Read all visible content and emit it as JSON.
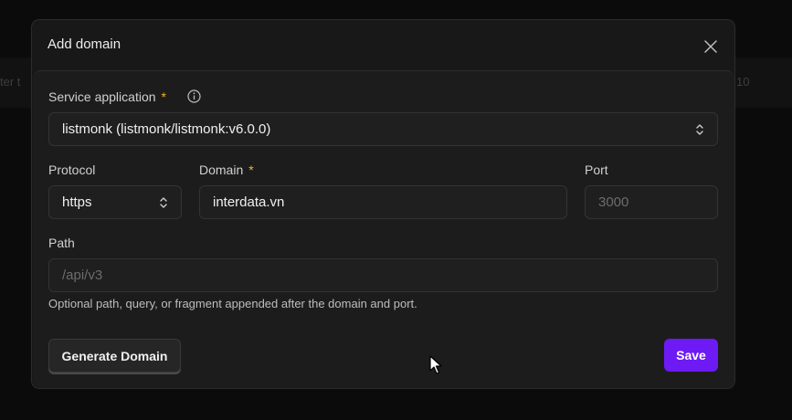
{
  "background": {
    "left_text": "ter t",
    "right_text": "10"
  },
  "dialog": {
    "title": "Add domain",
    "close_icon": "close-icon"
  },
  "form": {
    "service": {
      "label": "Service application",
      "required_mark": "*",
      "value": "listmonk (listmonk/listmonk:v6.0.0)"
    },
    "protocol": {
      "label": "Protocol",
      "value": "https"
    },
    "domain": {
      "label": "Domain",
      "required_mark": "*",
      "value": "interdata.vn"
    },
    "port": {
      "label": "Port",
      "placeholder": "3000"
    },
    "path": {
      "label": "Path",
      "placeholder": "/api/v3",
      "hint": "Optional path, query, or fragment appended after the domain and port."
    }
  },
  "actions": {
    "generate_label": "Generate Domain",
    "save_label": "Save"
  },
  "colors": {
    "accent": "#6d1af5",
    "required": "#f5b522"
  }
}
